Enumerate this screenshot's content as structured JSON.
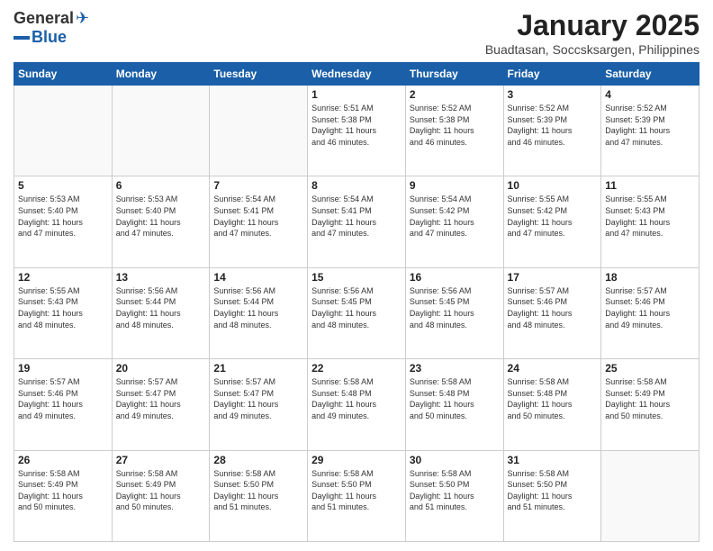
{
  "logo": {
    "general": "General",
    "blue": "Blue"
  },
  "title": "January 2025",
  "subtitle": "Buadtasan, Soccsksargen, Philippines",
  "days_header": [
    "Sunday",
    "Monday",
    "Tuesday",
    "Wednesday",
    "Thursday",
    "Friday",
    "Saturday"
  ],
  "weeks": [
    [
      {
        "day": "",
        "info": ""
      },
      {
        "day": "",
        "info": ""
      },
      {
        "day": "",
        "info": ""
      },
      {
        "day": "1",
        "info": "Sunrise: 5:51 AM\nSunset: 5:38 PM\nDaylight: 11 hours\nand 46 minutes."
      },
      {
        "day": "2",
        "info": "Sunrise: 5:52 AM\nSunset: 5:38 PM\nDaylight: 11 hours\nand 46 minutes."
      },
      {
        "day": "3",
        "info": "Sunrise: 5:52 AM\nSunset: 5:39 PM\nDaylight: 11 hours\nand 46 minutes."
      },
      {
        "day": "4",
        "info": "Sunrise: 5:52 AM\nSunset: 5:39 PM\nDaylight: 11 hours\nand 47 minutes."
      }
    ],
    [
      {
        "day": "5",
        "info": "Sunrise: 5:53 AM\nSunset: 5:40 PM\nDaylight: 11 hours\nand 47 minutes."
      },
      {
        "day": "6",
        "info": "Sunrise: 5:53 AM\nSunset: 5:40 PM\nDaylight: 11 hours\nand 47 minutes."
      },
      {
        "day": "7",
        "info": "Sunrise: 5:54 AM\nSunset: 5:41 PM\nDaylight: 11 hours\nand 47 minutes."
      },
      {
        "day": "8",
        "info": "Sunrise: 5:54 AM\nSunset: 5:41 PM\nDaylight: 11 hours\nand 47 minutes."
      },
      {
        "day": "9",
        "info": "Sunrise: 5:54 AM\nSunset: 5:42 PM\nDaylight: 11 hours\nand 47 minutes."
      },
      {
        "day": "10",
        "info": "Sunrise: 5:55 AM\nSunset: 5:42 PM\nDaylight: 11 hours\nand 47 minutes."
      },
      {
        "day": "11",
        "info": "Sunrise: 5:55 AM\nSunset: 5:43 PM\nDaylight: 11 hours\nand 47 minutes."
      }
    ],
    [
      {
        "day": "12",
        "info": "Sunrise: 5:55 AM\nSunset: 5:43 PM\nDaylight: 11 hours\nand 48 minutes."
      },
      {
        "day": "13",
        "info": "Sunrise: 5:56 AM\nSunset: 5:44 PM\nDaylight: 11 hours\nand 48 minutes."
      },
      {
        "day": "14",
        "info": "Sunrise: 5:56 AM\nSunset: 5:44 PM\nDaylight: 11 hours\nand 48 minutes."
      },
      {
        "day": "15",
        "info": "Sunrise: 5:56 AM\nSunset: 5:45 PM\nDaylight: 11 hours\nand 48 minutes."
      },
      {
        "day": "16",
        "info": "Sunrise: 5:56 AM\nSunset: 5:45 PM\nDaylight: 11 hours\nand 48 minutes."
      },
      {
        "day": "17",
        "info": "Sunrise: 5:57 AM\nSunset: 5:46 PM\nDaylight: 11 hours\nand 48 minutes."
      },
      {
        "day": "18",
        "info": "Sunrise: 5:57 AM\nSunset: 5:46 PM\nDaylight: 11 hours\nand 49 minutes."
      }
    ],
    [
      {
        "day": "19",
        "info": "Sunrise: 5:57 AM\nSunset: 5:46 PM\nDaylight: 11 hours\nand 49 minutes."
      },
      {
        "day": "20",
        "info": "Sunrise: 5:57 AM\nSunset: 5:47 PM\nDaylight: 11 hours\nand 49 minutes."
      },
      {
        "day": "21",
        "info": "Sunrise: 5:57 AM\nSunset: 5:47 PM\nDaylight: 11 hours\nand 49 minutes."
      },
      {
        "day": "22",
        "info": "Sunrise: 5:58 AM\nSunset: 5:48 PM\nDaylight: 11 hours\nand 49 minutes."
      },
      {
        "day": "23",
        "info": "Sunrise: 5:58 AM\nSunset: 5:48 PM\nDaylight: 11 hours\nand 50 minutes."
      },
      {
        "day": "24",
        "info": "Sunrise: 5:58 AM\nSunset: 5:48 PM\nDaylight: 11 hours\nand 50 minutes."
      },
      {
        "day": "25",
        "info": "Sunrise: 5:58 AM\nSunset: 5:49 PM\nDaylight: 11 hours\nand 50 minutes."
      }
    ],
    [
      {
        "day": "26",
        "info": "Sunrise: 5:58 AM\nSunset: 5:49 PM\nDaylight: 11 hours\nand 50 minutes."
      },
      {
        "day": "27",
        "info": "Sunrise: 5:58 AM\nSunset: 5:49 PM\nDaylight: 11 hours\nand 50 minutes."
      },
      {
        "day": "28",
        "info": "Sunrise: 5:58 AM\nSunset: 5:50 PM\nDaylight: 11 hours\nand 51 minutes."
      },
      {
        "day": "29",
        "info": "Sunrise: 5:58 AM\nSunset: 5:50 PM\nDaylight: 11 hours\nand 51 minutes."
      },
      {
        "day": "30",
        "info": "Sunrise: 5:58 AM\nSunset: 5:50 PM\nDaylight: 11 hours\nand 51 minutes."
      },
      {
        "day": "31",
        "info": "Sunrise: 5:58 AM\nSunset: 5:50 PM\nDaylight: 11 hours\nand 51 minutes."
      },
      {
        "day": "",
        "info": ""
      }
    ]
  ]
}
